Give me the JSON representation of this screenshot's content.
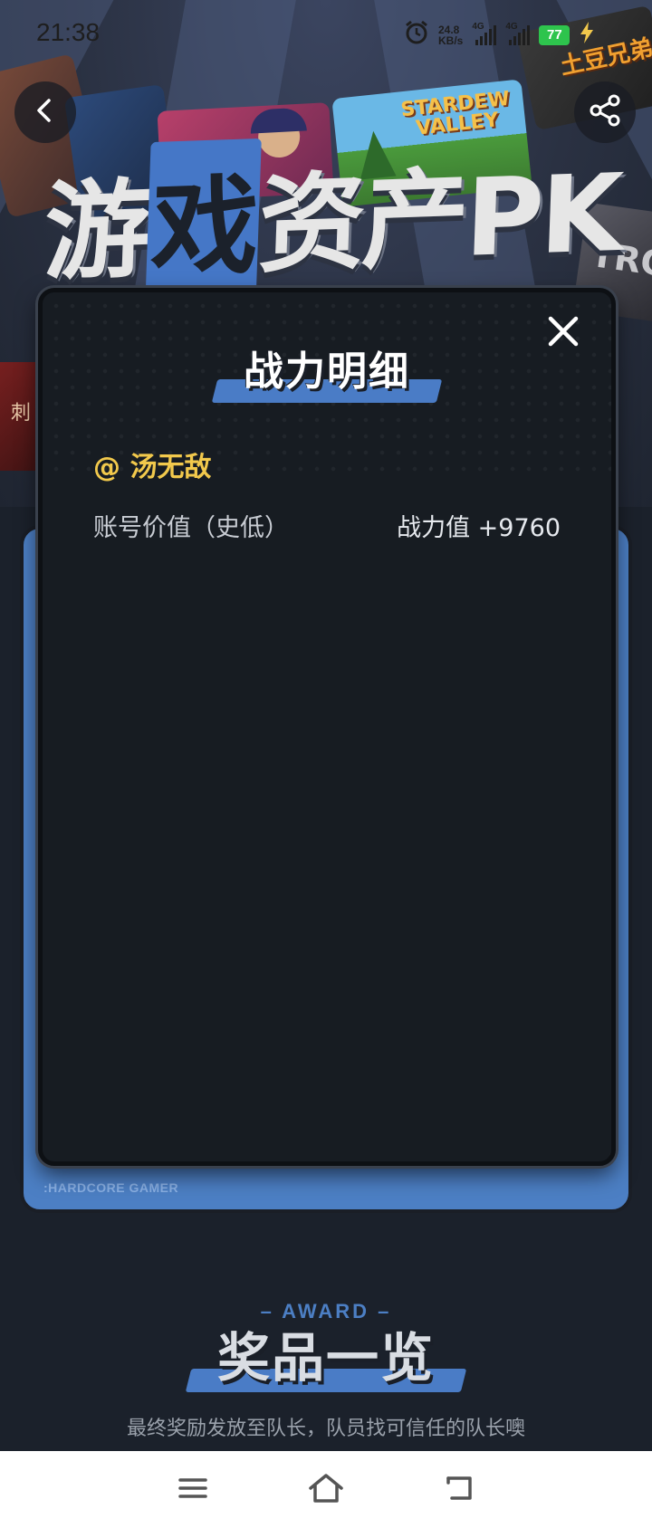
{
  "status_bar": {
    "time": "21:38",
    "net_speed_value": "24.8",
    "net_speed_unit": "KB/s",
    "signal1_label": "4G",
    "signal2_label": "4G",
    "battery": "77",
    "battery_color": "#2ec44d"
  },
  "header": {
    "title_part1": "游",
    "title_highlight": "戏",
    "title_part2": "资产PK",
    "tile_stardew": "STARDEW VALLEY",
    "tile_potato": "土豆兄弟",
    "tile_left_char": "刺",
    "tile_right_text": "TRO"
  },
  "dialog": {
    "title": "战力明细",
    "username": "@ 汤无敌",
    "rows": [
      {
        "label": "账号价值（史低）",
        "value": "战力值 +9760"
      }
    ]
  },
  "card": {
    "footer_label": ":HARDCORE GAMER"
  },
  "award": {
    "subtitle": "– AWARD –",
    "title": "奖品一览",
    "note": "最终奖励发放至队长，队员找可信任的队长噢"
  },
  "colors": {
    "accent_blue": "#4c7fc4",
    "username_yellow": "#f2c94c",
    "dialog_bg": "#171c22"
  },
  "icons": {
    "back": "chevron-left-icon",
    "share": "share-icon",
    "close": "close-icon",
    "menu": "menu-icon",
    "home": "home-icon",
    "return": "back-arrow-icon"
  }
}
